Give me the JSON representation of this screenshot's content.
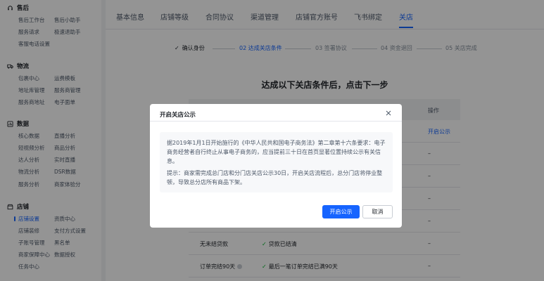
{
  "sidebar": {
    "sections": [
      {
        "title": "售后",
        "icon": "headset-icon",
        "items": [
          "售后工作台",
          "售后小助手",
          "服务请求",
          "极速退助手",
          "客服电话设置"
        ]
      },
      {
        "title": "物流",
        "icon": "truck-icon",
        "items": [
          "包裹中心",
          "运费模板",
          "地址库管理",
          "服务商管理",
          "服务商地址",
          "电子面单"
        ]
      },
      {
        "title": "数据",
        "icon": "chart-icon",
        "items": [
          "核心数据",
          "直播分析",
          "短视频分析",
          "商品分析",
          "达人分析",
          "实时直播",
          "物流分析",
          "DSR数据",
          "服务分析",
          "商家体验分"
        ]
      },
      {
        "title": "店铺",
        "icon": "store-icon",
        "items": [
          "店铺设置",
          "资质中心",
          "店铺装修",
          "支付方式设置",
          "子账号管理",
          "黑名单",
          "商家保障中心",
          "数据授权",
          "任务中心"
        ]
      }
    ]
  },
  "tabs": [
    "基本信息",
    "店铺等级",
    "合同协议",
    "渠道管理",
    "店铺官方账号",
    "飞书绑定",
    "关店"
  ],
  "active_tab": "关店",
  "steps": [
    {
      "label": "确认身份",
      "state": "done"
    },
    {
      "label": "02 达成关店条件",
      "state": "current"
    },
    {
      "label": "03 签署协议",
      "state": "todo"
    },
    {
      "label": "04 资金退回",
      "state": "todo"
    },
    {
      "label": "05 关店完成",
      "state": "todo"
    }
  ],
  "headline": "达成以下关店条件后，点击下一步",
  "table": {
    "op_header": "操作",
    "rows": [
      {
        "name": "",
        "status": "",
        "op": "开启公示",
        "op_type": "link"
      },
      {
        "name": "",
        "status": "",
        "op": "–",
        "op_type": "text"
      },
      {
        "name": "",
        "status": "",
        "op": "–",
        "op_type": "text"
      },
      {
        "name": "",
        "status": "",
        "op": "–",
        "op_type": "text"
      },
      {
        "name": "",
        "status": "",
        "op": "–",
        "op_type": "text"
      },
      {
        "name": "无未结贷款",
        "status": "贷款已结清",
        "op": "–",
        "op_type": "text"
      },
      {
        "name": "订单完结90天",
        "status": "最后一笔订单完结已满90天",
        "op": "–",
        "op_type": "text"
      }
    ]
  },
  "modal": {
    "title": "开启关店公示",
    "paragraph1": "据2019年1月1日开始施行的《中华人民共和国电子商务法》第二章第十六条要求：电子商务经营者自行终止从事电子商务的，应当提前三十日在首页显著位置持续公示有关信息。",
    "paragraph2": "提示：商家需完成总门店和分门店关店公示30日，开启关店流程后，总分门店将停业整顿，导致总分店所有商品下架。",
    "confirm_label": "开启公示",
    "cancel_label": "取消"
  },
  "colors": {
    "primary": "#1664ff",
    "success": "#00b42a"
  }
}
